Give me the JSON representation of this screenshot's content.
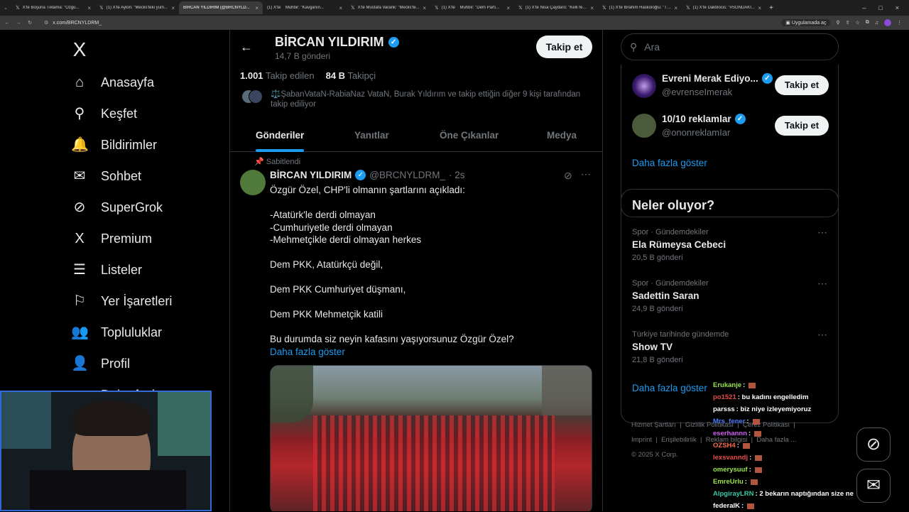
{
  "browser": {
    "tabs": [
      {
        "title": "X'te Boşuna Tıklama: \"Özgü..."
      },
      {
        "title": "(1) X'te Aylon: \"Meclis'teki yum..."
      },
      {
        "title": "BİRCAN YILDIRIM (@BRCNYLD..."
      },
      {
        "title": "(1) X'te    Muhbir: \"Kavganın..."
      },
      {
        "title": "X'te Mustafa Varank: \"Meclis'te..."
      },
      {
        "title": "(1) X'te    Muhbir: \"Dem Parti..."
      },
      {
        "title": "(1) X'te Nisa Çaydaro: \"Kelli felli..."
      },
      {
        "title": "(1) X'te İbrahim Haskoloğlu: \"TE..."
      },
      {
        "title": "(1) X'te Daktilocis: \"#SONDAKİ..."
      }
    ],
    "new_tab": "+",
    "url": "x.com/BRCNYLDRM_",
    "app_label": "Uygulamada aç"
  },
  "sidebar": {
    "logo": "X",
    "items": [
      {
        "label": "Anasayfa",
        "icon": "⌂"
      },
      {
        "label": "Keşfet",
        "icon": "⚲"
      },
      {
        "label": "Bildirimler",
        "icon": "🔔"
      },
      {
        "label": "Sohbet",
        "icon": "✉"
      },
      {
        "label": "SuperGrok",
        "icon": "⊘"
      },
      {
        "label": "Premium",
        "icon": "X"
      },
      {
        "label": "Listeler",
        "icon": "☰"
      },
      {
        "label": "Yer İşaretleri",
        "icon": "⚐"
      },
      {
        "label": "Topluluklar",
        "icon": "👥"
      },
      {
        "label": "Profil",
        "icon": "👤"
      },
      {
        "label": "Daha fazla",
        "icon": "⋯"
      }
    ]
  },
  "profile": {
    "name": "BİRCAN YILDIRIM",
    "posts_count": "14,7 B gönderi",
    "follow_label": "Takip et",
    "following_count": "1.001",
    "following_label": "Takip edilen",
    "followers_count": "84 B",
    "followers_label": "Takipçi",
    "followed_by": "⚖️ŞabanVataN-RabiaNaz VataN, Burak Yıldırım ve takip ettiğin diğer 9 kişi tarafından takip ediliyor",
    "tabs": [
      "Gönderiler",
      "Yanıtlar",
      "Öne Çıkanlar",
      "Medya"
    ]
  },
  "post": {
    "pinned_label": "Sabitlendi",
    "author": "BİRCAN YILDIRIM",
    "handle": "@BRCNYLDRM_",
    "time": "· 2s",
    "lines": [
      "Özgür Özel, CHP'li olmanın şartlarını açıkladı:",
      "",
      "-Atatürk'le derdi olmayan",
      "-Cumhuriyetle derdi olmayan",
      "-Mehmetçikle derdi olmayan herkes",
      "",
      "Dem PKK, Atatürkçü değil,",
      "",
      "Dem PKK Cumhuriyet düşmanı,",
      "",
      "Dem PKK Mehmetçik katili",
      "",
      "Bu durumda siz neyin kafasını yaşıyorsunuz Özgür Özel?"
    ],
    "show_more": "Daha fazla göster"
  },
  "search": {
    "placeholder": "Ara"
  },
  "who_to_follow": {
    "users": [
      {
        "name": "Evreni Merak Ediyo...",
        "handle": "@evrenseImerak",
        "button": "Takip et"
      },
      {
        "name": "10/10 reklamlar",
        "handle": "@ononreklamIar",
        "button": "Takip et"
      }
    ],
    "show_more": "Daha fazla göster"
  },
  "trends": {
    "title": "Neler oluyor?",
    "items": [
      {
        "context": "Spor · Gündemdekiler",
        "name": "Ela Rümeysa Cebeci",
        "count": "20,5 B gönderi"
      },
      {
        "context": "Spor · Gündemdekiler",
        "name": "Sadettin Saran",
        "count": "24,9 B gönderi"
      },
      {
        "context": "Türkiye tarihinde gündemde",
        "name": "Show TV",
        "count": "21,8 B gönderi"
      }
    ],
    "show_more": "Daha fazla göster"
  },
  "footer": {
    "links": [
      "Hizmet Şartları",
      "Gizlilik Politikası",
      "Çerez Politikası",
      "Imprint",
      "Erişilebilirlik",
      "Reklam bilgisi",
      "Daha fazla ..."
    ],
    "copyright": "© 2025 X Corp."
  },
  "chat": {
    "messages": [
      {
        "user": "Erukanje",
        "text": "",
        "color": "#9ae64a"
      },
      {
        "user": "po1521",
        "text": ": bu kadını engelledim",
        "color": "#e34b4b"
      },
      {
        "user": "parsss",
        "text": ": biz niye izleyemiyoruz",
        "color": "#ffffff"
      },
      {
        "user": "Mrs_fener",
        "text": ":",
        "color": "#4f7dff"
      },
      {
        "user": "eserhannn",
        "text": ":",
        "color": "#d15ef2"
      },
      {
        "user": "OZSH4",
        "text": ":",
        "color": "#ff6b4a"
      },
      {
        "user": "lexsvanndj",
        "text": ":",
        "color": "#e84a4a"
      },
      {
        "user": "omerysuuf",
        "text": ":",
        "color": "#9ae64a"
      },
      {
        "user": "EmreUrlu",
        "text": ":",
        "color": "#9ae64a"
      },
      {
        "user": "AlpgirayLRN",
        "text": ": 2 bekarın naptığından size ne",
        "color": "#38c9a5"
      },
      {
        "user": "federalK",
        "text": ":",
        "color": "#ffffff"
      }
    ]
  },
  "colors": {
    "accent": "#1d9bf0",
    "background": "#000000",
    "border": "#2f3336"
  }
}
